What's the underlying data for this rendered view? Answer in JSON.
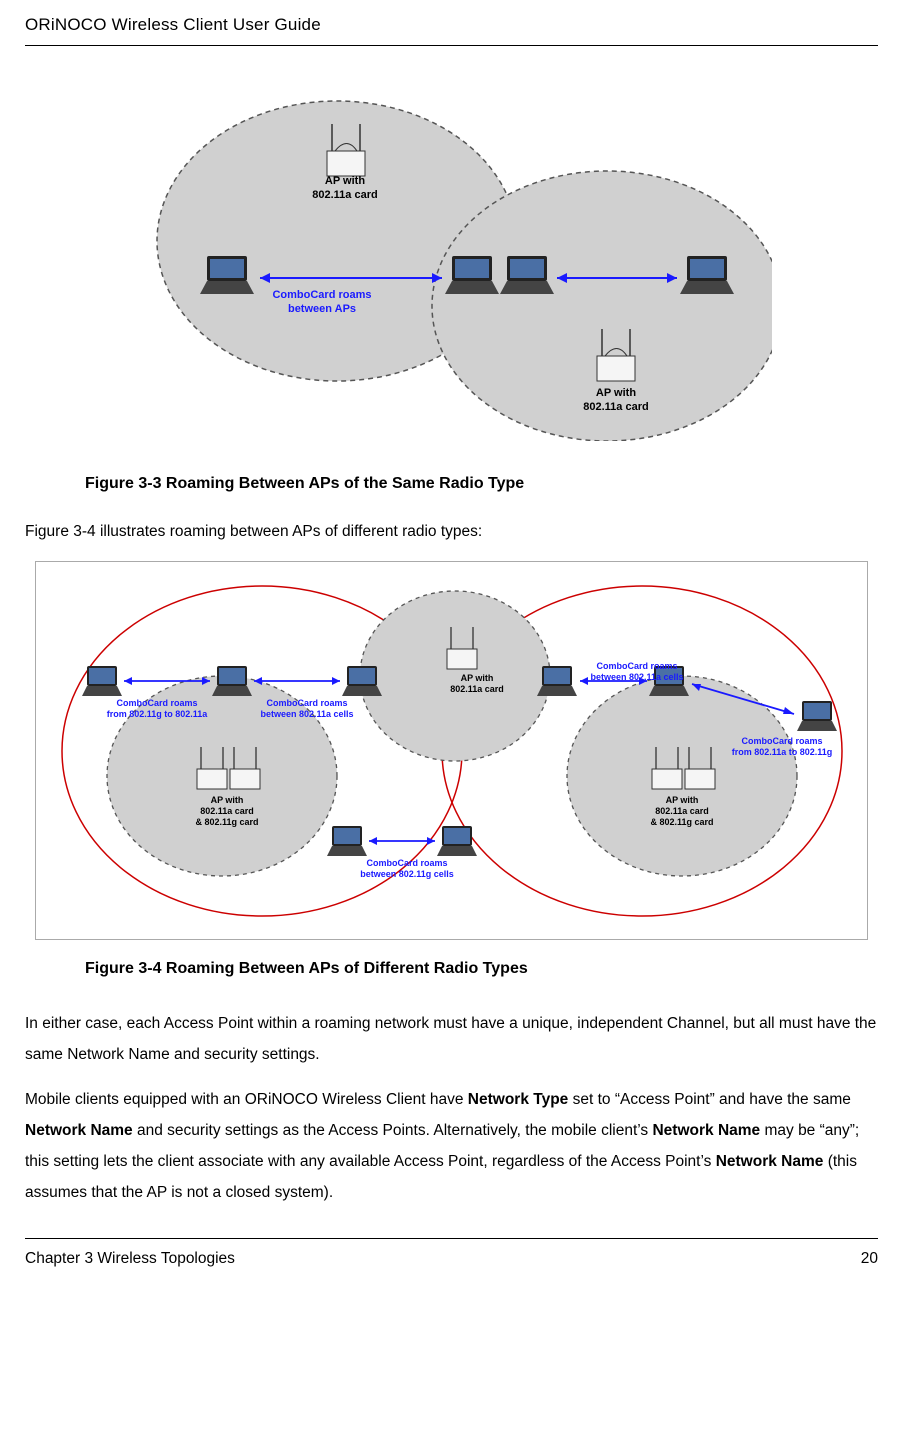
{
  "header": {
    "title": "ORiNOCO Wireless Client User Guide"
  },
  "figure1": {
    "caption": "Figure 3-3  Roaming Between APs of the Same Radio Type",
    "ap1_line1": "AP with",
    "ap1_line2": "802.11a card",
    "roam_line1": "ComboCard roams",
    "roam_line2": "between APs",
    "ap2_line1": "AP with",
    "ap2_line2": "802.11a card"
  },
  "para1": "Figure 3-4 illustrates roaming between APs of different radio types:",
  "figure2": {
    "caption": "Figure 3-4  Roaming Between APs of Different Radio Types",
    "leftroam_line1": "ComboCard roams",
    "leftroam_line2": "from 802.11g to 802.11a",
    "midroam1_line1": "ComboCard roams",
    "midroam1_line2": "between 802.11a cells",
    "topap_line1": "AP with",
    "topap_line2": "802.11a card",
    "rightroam1_line1": "ComboCard roams",
    "rightroam1_line2": "between 802.11a cells",
    "rightroam2_line1": "ComboCard roams",
    "rightroam2_line2": "from 802.11a to 802.11g",
    "leftap_line1": "AP with",
    "leftap_line2": "802.11a card",
    "leftap_line3": "& 802.11g card",
    "rightap_line1": "AP with",
    "rightap_line2": "802.11a card",
    "rightap_line3": "& 802.11g card",
    "bottomroam_line1": "ComboCard roams",
    "bottomroam_line2": "between 802.11g cells"
  },
  "para2": {
    "text": "In either case, each Access Point within a roaming network must have a unique, independent Channel, but all must have the same Network Name and security settings."
  },
  "para3": {
    "t1": "Mobile clients equipped with an ORiNOCO Wireless Client have ",
    "b1": "Network Type",
    "t2": " set to “Access Point” and have the same ",
    "b2": "Network Name",
    "t3": " and security settings as the Access Points. Alternatively, the mobile client’s ",
    "b3": "Network Name",
    "t4": " may be “any”; this setting lets the client associate with any available Access Point, regardless of the Access Point’s ",
    "b4": "Network Name",
    "t5": " (this assumes that the AP is not a closed system)."
  },
  "footer": {
    "left": "Chapter 3 Wireless Topologies",
    "right": "20"
  }
}
